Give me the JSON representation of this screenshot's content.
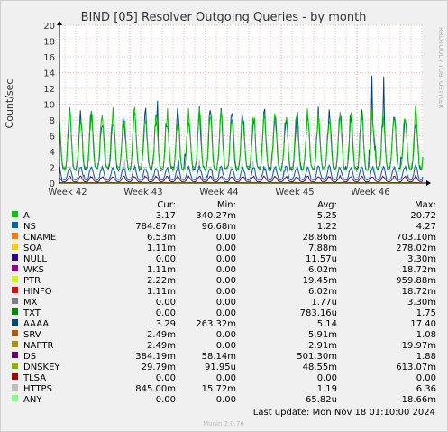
{
  "chart_data": {
    "type": "line",
    "title": "BIND [05] Resolver Outgoing Queries - by month",
    "ylabel": "Count/sec",
    "xlabel": "",
    "ylim": [
      0,
      20
    ],
    "y_ticks": [
      0,
      2,
      4,
      6,
      8,
      10,
      12,
      14,
      16,
      18,
      20
    ],
    "x_ticks": [
      "Week 42",
      "Week 43",
      "Week 44",
      "Week 45",
      "Week 46"
    ],
    "grid": true,
    "side_label": "RRDTOOL / TOBI OETIKER",
    "legend_headers": [
      "Cur:",
      "Min:",
      "Avg:",
      "Max:"
    ],
    "series": [
      {
        "name": "A",
        "color": "#00cc00",
        "cur": "3.17",
        "min": "340.27m",
        "avg": "5.25",
        "max": "20.72"
      },
      {
        "name": "NS",
        "color": "#0066b3",
        "cur": "784.87m",
        "min": "96.68m",
        "avg": "1.22",
        "max": "4.27"
      },
      {
        "name": "CNAME",
        "color": "#ff8000",
        "cur": "6.53m",
        "min": "0.00",
        "avg": "28.86m",
        "max": "703.10m"
      },
      {
        "name": "SOA",
        "color": "#ffcc00",
        "cur": "1.11m",
        "min": "0.00",
        "avg": "7.88m",
        "max": "278.02m"
      },
      {
        "name": "NULL",
        "color": "#330099",
        "cur": "0.00",
        "min": "0.00",
        "avg": "11.57u",
        "max": "3.30m"
      },
      {
        "name": "WKS",
        "color": "#990099",
        "cur": "1.11m",
        "min": "0.00",
        "avg": "6.02m",
        "max": "18.72m"
      },
      {
        "name": "PTR",
        "color": "#ccff00",
        "cur": "2.22m",
        "min": "0.00",
        "avg": "19.45m",
        "max": "959.88m"
      },
      {
        "name": "HINFO",
        "color": "#ff0000",
        "cur": "1.11m",
        "min": "0.00",
        "avg": "6.02m",
        "max": "18.72m"
      },
      {
        "name": "MX",
        "color": "#808080",
        "cur": "0.00",
        "min": "0.00",
        "avg": "1.77u",
        "max": "3.30m"
      },
      {
        "name": "TXT",
        "color": "#008f00",
        "cur": "0.00",
        "min": "0.00",
        "avg": "783.16u",
        "max": "1.75"
      },
      {
        "name": "AAAA",
        "color": "#00487d",
        "cur": "3.29",
        "min": "263.32m",
        "avg": "5.14",
        "max": "17.40"
      },
      {
        "name": "SRV",
        "color": "#b35a00",
        "cur": "2.49m",
        "min": "0.00",
        "avg": "5.91m",
        "max": "1.08"
      },
      {
        "name": "NAPTR",
        "color": "#b38f00",
        "cur": "2.49m",
        "min": "0.00",
        "avg": "2.91m",
        "max": "19.97m"
      },
      {
        "name": "DS",
        "color": "#6b006b",
        "cur": "384.19m",
        "min": "58.14m",
        "avg": "501.30m",
        "max": "1.88"
      },
      {
        "name": "DNSKEY",
        "color": "#8fb300",
        "cur": "29.79m",
        "min": "91.95u",
        "avg": "48.55m",
        "max": "613.07m"
      },
      {
        "name": "TLSA",
        "color": "#b30000",
        "cur": "0.00",
        "min": "0.00",
        "avg": "0.00",
        "max": "0.00"
      },
      {
        "name": "HTTPS",
        "color": "#bebebe",
        "cur": "845.00m",
        "min": "15.72m",
        "avg": "1.19",
        "max": "6.36"
      },
      {
        "name": "ANY",
        "color": "#80ff80",
        "cur": "0.00",
        "min": "0.00",
        "avg": "65.82u",
        "max": "18.66m"
      }
    ],
    "last_update": "Last update: Mon Nov 18 01:10:00 2024",
    "footer": "Munin 2.0.76"
  }
}
